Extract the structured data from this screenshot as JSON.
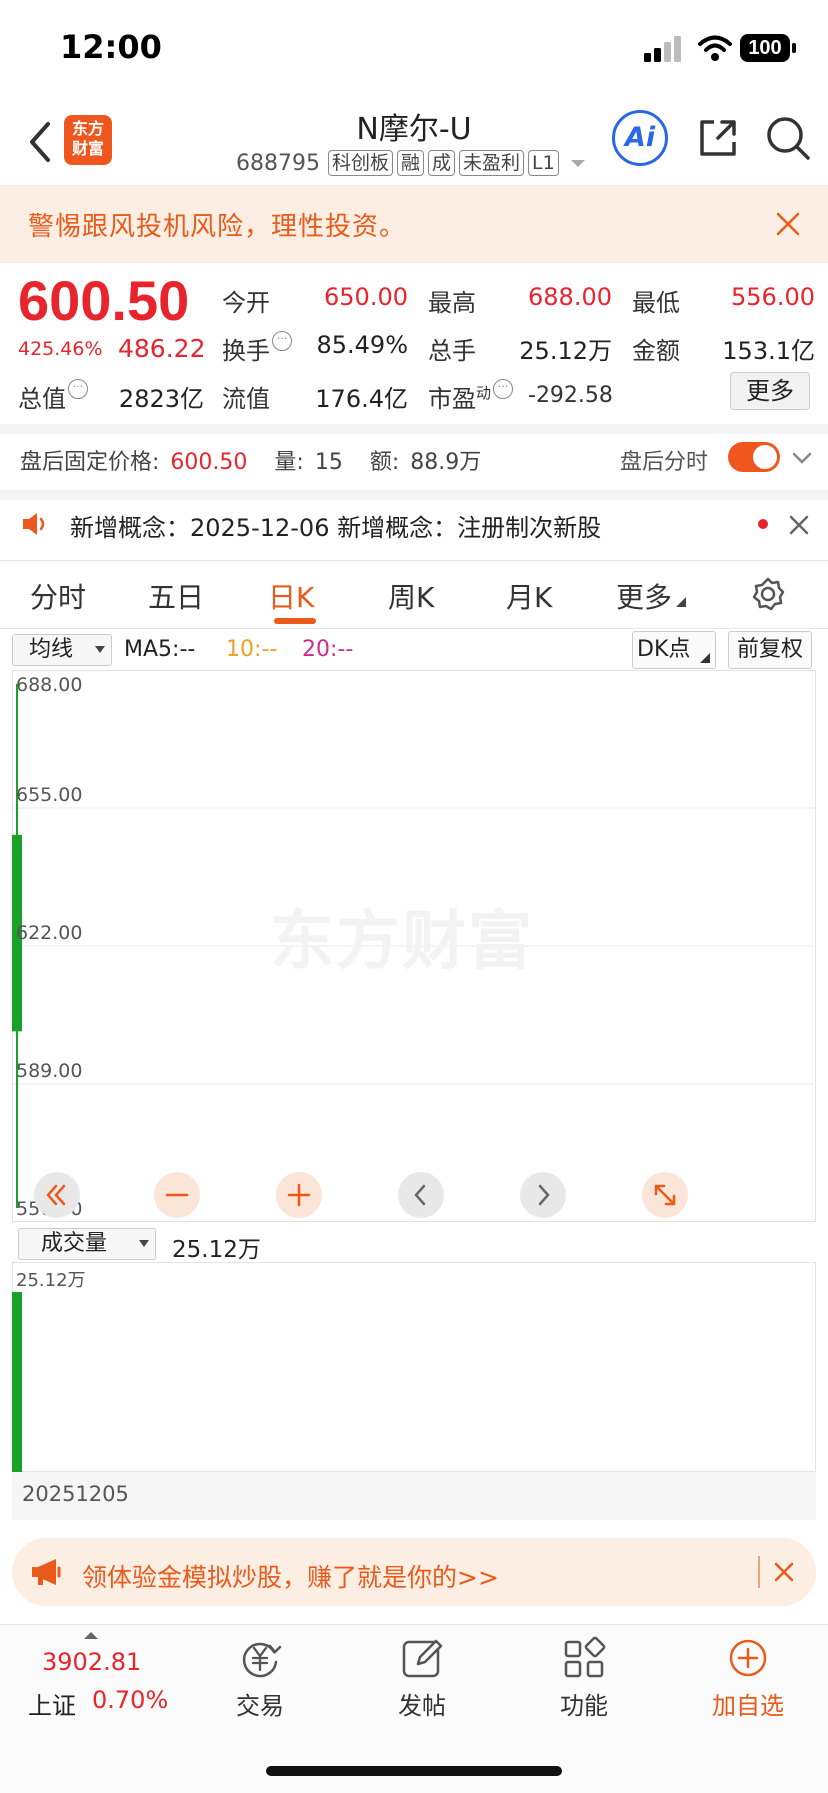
{
  "status_bar": {
    "time": "12:00",
    "battery": "100"
  },
  "header": {
    "logo_line1": "东方",
    "logo_line2": "财富",
    "stock_name": "N摩尔-U",
    "stock_code": "688795",
    "tags": [
      "科创板",
      "融",
      "成",
      "未盈利",
      "L1"
    ],
    "ai_label": "Ai"
  },
  "warning": {
    "text": "警惕跟风投机风险，理性投资。"
  },
  "quote": {
    "price": "600.50",
    "change_pct": "425.46%",
    "change_amt": "486.22",
    "open_label": "今开",
    "open": "650.00",
    "high_label": "最高",
    "high": "688.00",
    "low_label": "最低",
    "low": "556.00",
    "turnover_label": "换手",
    "turnover": "85.49%",
    "volume_label": "总手",
    "volume": "25.12万",
    "amount_label": "金额",
    "amount": "153.1亿",
    "mktcap_label": "总值",
    "mktcap": "2823亿",
    "float_label": "流值",
    "float_cap": "176.4亿",
    "pe_label": "市盈",
    "pe_sup": "动",
    "pe": "-292.58",
    "more_button": "更多"
  },
  "after_hours": {
    "price_label": "盘后固定价格:",
    "price": "600.50",
    "vol_label": "量:",
    "vol": "15",
    "amt_label": "额:",
    "amt": "88.9万",
    "intraday_label": "盘后分时",
    "toggle_on": true
  },
  "concept": {
    "text": "新增概念：2025-12-06 新增概念：注册制次新股"
  },
  "tabs": [
    "分时",
    "五日",
    "日K",
    "周K",
    "月K",
    "更多"
  ],
  "active_tab": "日K",
  "indicator_bar": {
    "ma_select": "均线",
    "ma5": "MA5:--",
    "ma10": "10:--",
    "ma20": "20:--",
    "dk_button": "DK点",
    "adjust_button": "前复权"
  },
  "kline_chart": {
    "y_labels": [
      "688.00",
      "655.00",
      "622.00",
      "589.00",
      "556.00"
    ],
    "watermark": "东方财富",
    "colors": {
      "up": "#e8242c",
      "down": "#1aa12a",
      "accent": "#ea5a1a"
    }
  },
  "volume_chart": {
    "select": "成交量",
    "value": "25.12万",
    "y_label": "25.12万",
    "date": "20251205"
  },
  "chart_data": {
    "type": "candlestick",
    "dates": [
      "20251205"
    ],
    "open": [
      650.0
    ],
    "high": [
      688.0
    ],
    "low": [
      556.0
    ],
    "close": [
      600.5
    ],
    "volume_wan": [
      25.12
    ],
    "ylim": [
      556.0,
      688.0
    ]
  },
  "promo": {
    "text": "领体验金模拟炒股，赚了就是你的>>"
  },
  "bottom_bar": {
    "index_value": "3902.81",
    "index_name": "上证",
    "index_change": "0.70%",
    "items": [
      "交易",
      "发帖",
      "功能",
      "加自选"
    ]
  }
}
